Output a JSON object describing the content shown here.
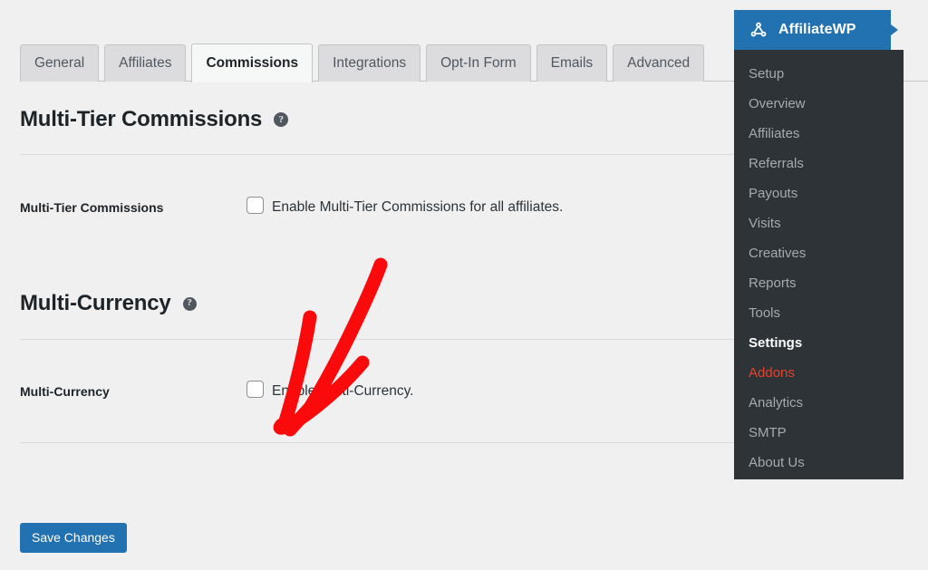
{
  "tabs": [
    {
      "label": "General",
      "active": false
    },
    {
      "label": "Affiliates",
      "active": false
    },
    {
      "label": "Commissions",
      "active": true
    },
    {
      "label": "Integrations",
      "active": false
    },
    {
      "label": "Opt-In Form",
      "active": false
    },
    {
      "label": "Emails",
      "active": false
    },
    {
      "label": "Advanced",
      "active": false
    }
  ],
  "sections": [
    {
      "heading": "Multi-Tier Commissions",
      "help_icon": "question-mark-icon",
      "field_label": "Multi-Tier Commissions",
      "checkbox_label": "Enable Multi-Tier Commissions for all affiliates.",
      "checked": false
    },
    {
      "heading": "Multi-Currency",
      "help_icon": "question-mark-icon",
      "field_label": "Multi-Currency",
      "checkbox_label": "Enable Multi-Currency.",
      "checked": false
    }
  ],
  "save_button": {
    "label": "Save Changes"
  },
  "affiliatewp_panel": {
    "brand": "AffiliateWP",
    "logo_icon": "share-network-icon",
    "items": [
      {
        "label": "Setup",
        "state": "normal"
      },
      {
        "label": "Overview",
        "state": "normal"
      },
      {
        "label": "Affiliates",
        "state": "normal"
      },
      {
        "label": "Referrals",
        "state": "normal"
      },
      {
        "label": "Payouts",
        "state": "normal"
      },
      {
        "label": "Visits",
        "state": "normal"
      },
      {
        "label": "Creatives",
        "state": "normal"
      },
      {
        "label": "Reports",
        "state": "normal"
      },
      {
        "label": "Tools",
        "state": "normal"
      },
      {
        "label": "Settings",
        "state": "current"
      },
      {
        "label": "Addons",
        "state": "highlight"
      },
      {
        "label": "Analytics",
        "state": "normal"
      },
      {
        "label": "SMTP",
        "state": "normal"
      },
      {
        "label": "About Us",
        "state": "normal"
      }
    ]
  },
  "annotation": {
    "type": "red-arrow",
    "points_to": "multi-currency-checkbox",
    "color": "#fa0a0a"
  },
  "colors": {
    "page_background": "#f0f0f1",
    "accent_blue": "#2271b1",
    "panel_dark": "#2e3338",
    "tab_inactive": "#dcdcde",
    "tab_active": "#f6f7f7",
    "annotation_red": "#fa0a0a",
    "addons_red": "#e8402a"
  }
}
